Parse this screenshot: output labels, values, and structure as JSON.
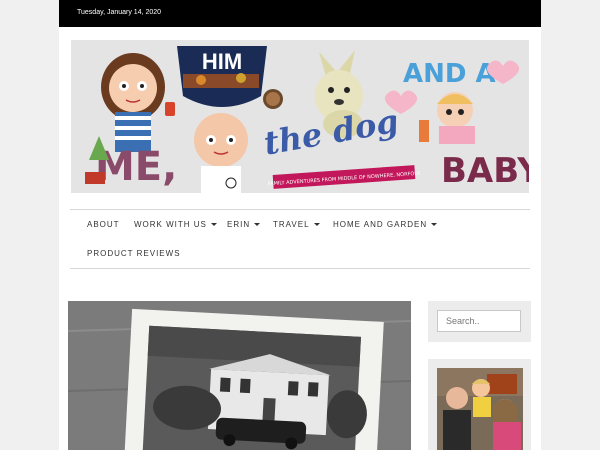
{
  "topbar": {
    "date": "Tuesday, January 14, 2020"
  },
  "banner": {
    "word_me": "ME,",
    "word_him": "HIM",
    "word_the_dog": "the dog",
    "word_and_a": "AND A",
    "word_baby": "BABY!",
    "tagline": "FAMILY ADVENTURES FROM MIDDLE OF NOWHERE, NORFOLK"
  },
  "nav": {
    "items": [
      {
        "label": "ABOUT",
        "dropdown": false
      },
      {
        "label": "WORK WITH US",
        "dropdown": true
      },
      {
        "label": "ERIN",
        "dropdown": true
      },
      {
        "label": "TRAVEL",
        "dropdown": true
      },
      {
        "label": "HOME AND GARDEN",
        "dropdown": true
      },
      {
        "label": "PRODUCT REVIEWS",
        "dropdown": false
      }
    ]
  },
  "sidebar": {
    "search_placeholder": "Search.."
  },
  "colors": {
    "topbar": "#000000",
    "page_bg": "#f0f0f0",
    "text": "#333333",
    "accent_pink": "#c2185b"
  }
}
